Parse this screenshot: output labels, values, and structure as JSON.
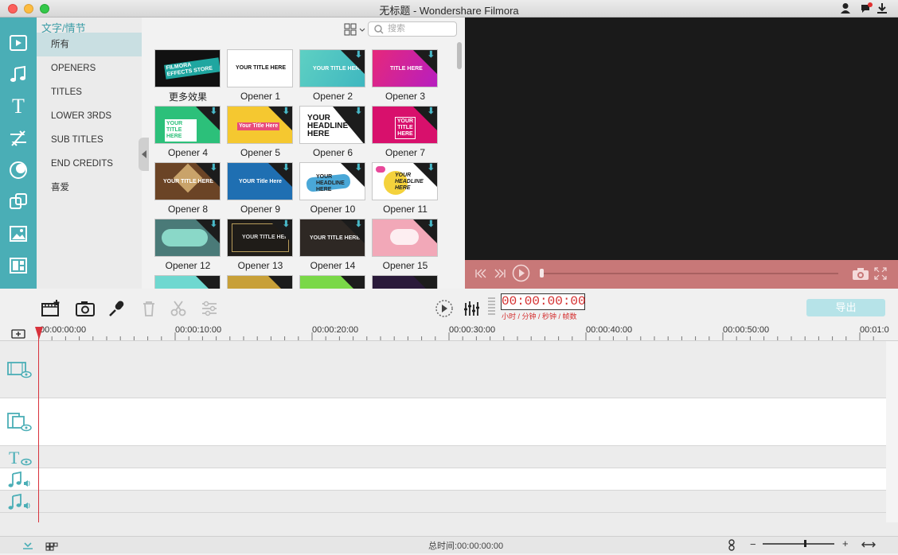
{
  "window": {
    "title": "无标题 - Wondershare Filmora"
  },
  "sidebar": {
    "header": "文字/情节",
    "items": [
      {
        "label": "所有"
      },
      {
        "label": "OPENERS"
      },
      {
        "label": "TITLES"
      },
      {
        "label": "LOWER 3RDS"
      },
      {
        "label": "SUB TITLES"
      },
      {
        "label": "END CREDITS"
      },
      {
        "label": "喜爱"
      }
    ]
  },
  "gallery": {
    "search_placeholder": "搜索",
    "items": [
      {
        "label": "更多效果",
        "text": "FILMORA EFFECTS STORE"
      },
      {
        "label": "Opener 1",
        "text": "YOUR TITLE HERE"
      },
      {
        "label": "Opener 2",
        "text": "YOUR TITLE HERE"
      },
      {
        "label": "Opener 3",
        "text": "TITLE HERE"
      },
      {
        "label": "Opener 4",
        "text": "YOUR TITLE HERE"
      },
      {
        "label": "Opener 5",
        "text": "Your Title Here"
      },
      {
        "label": "Opener 6",
        "text": "YOUR HEADLINE HERE"
      },
      {
        "label": "Opener 7",
        "text": "YOUR TITLE HERE"
      },
      {
        "label": "Opener 8",
        "text": "YOUR TITLE HERE"
      },
      {
        "label": "Opener 9",
        "text": "YOUR Title Here"
      },
      {
        "label": "Opener 10",
        "text": "YOUR HEADLINE HERE"
      },
      {
        "label": "Opener 11",
        "text": "YOUR HEADLINE HERE"
      },
      {
        "label": "Opener 12",
        "text": ""
      },
      {
        "label": "Opener 13",
        "text": "YOUR TITLE HERE"
      },
      {
        "label": "Opener 14",
        "text": "YOUR TITLE HERE"
      },
      {
        "label": "Opener 15",
        "text": ""
      }
    ]
  },
  "timeline": {
    "timecode": "00:00:00:00",
    "timecode_units": "小时 / 分钟 / 秒钟 / 帧数",
    "export_label": "导出",
    "ruler_labels": [
      "00:00:00:00",
      "00:00:10:00",
      "00:00:20:00",
      "00:00:30:00",
      "00:00:40:00",
      "00:00:50:00",
      "00:01:0"
    ],
    "total_time": "总时间:00:00:00:00"
  },
  "colors": {
    "accent": "#4aaeb6",
    "timecode": "#d42d2d",
    "preview_bar": "#c87878"
  }
}
